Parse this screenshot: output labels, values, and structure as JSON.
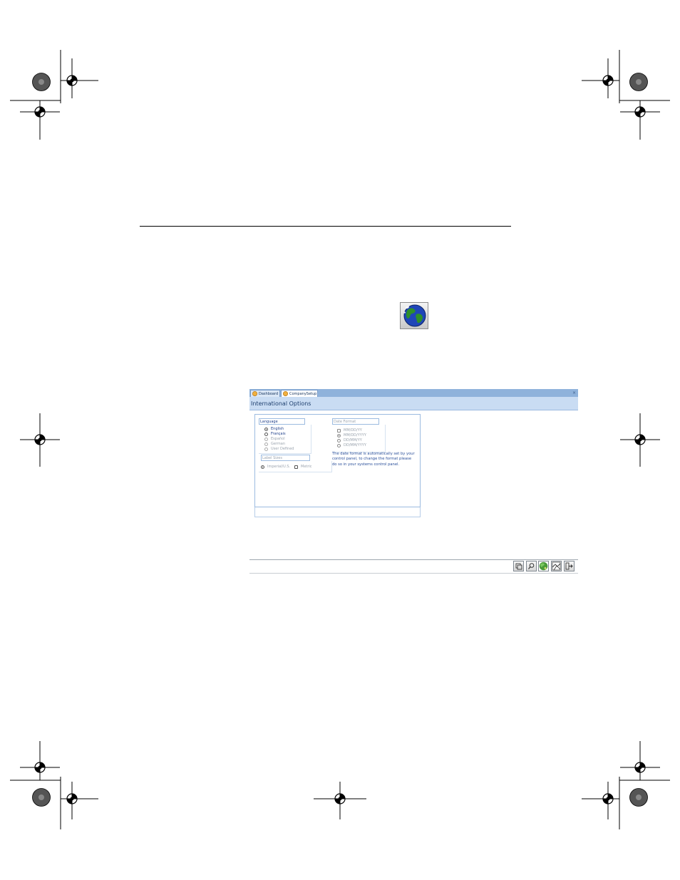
{
  "window": {
    "tabs": [
      {
        "label": "Dashboard",
        "active": false
      },
      {
        "label": "CompanySetup",
        "active": true
      }
    ],
    "close_glyph": "×",
    "header_title": "International Options"
  },
  "language_group": {
    "title": "Language",
    "options": [
      {
        "label": "English",
        "selected": true,
        "enabled": true
      },
      {
        "label": "Français",
        "selected": false,
        "enabled": true
      },
      {
        "label": "Español",
        "selected": false,
        "enabled": false
      },
      {
        "label": "German",
        "selected": false,
        "enabled": false
      },
      {
        "label": "User Defined",
        "selected": false,
        "enabled": false
      }
    ]
  },
  "label_sizes_group": {
    "title": "Label Sizes",
    "options": [
      {
        "label": "Imperial/U.S.",
        "selected": true
      },
      {
        "label": "Metric",
        "selected": false
      }
    ]
  },
  "date_format_group": {
    "title": "Date Format",
    "options": [
      {
        "label": "MM/DD/YY",
        "selected": false
      },
      {
        "label": "MM/DD/YYYY",
        "selected": true
      },
      {
        "label": "DD/MM/YY",
        "selected": false
      },
      {
        "label": "DD/MM/YYYY",
        "selected": false
      }
    ],
    "note": "The date format is automatically set by your control panel, to change the format please do so in your systems control panel."
  },
  "toolbar": {
    "buttons": [
      {
        "icon": "copy-icon"
      },
      {
        "icon": "search-icon"
      },
      {
        "icon": "globe-icon"
      },
      {
        "icon": "map-icon"
      },
      {
        "icon": "exit-icon"
      }
    ]
  },
  "colors": {
    "tabbar": "#8fb2db",
    "header": "#c9dcf3",
    "label_blue": "#1e3f8a",
    "disabled_gray": "#9aa3ae"
  }
}
